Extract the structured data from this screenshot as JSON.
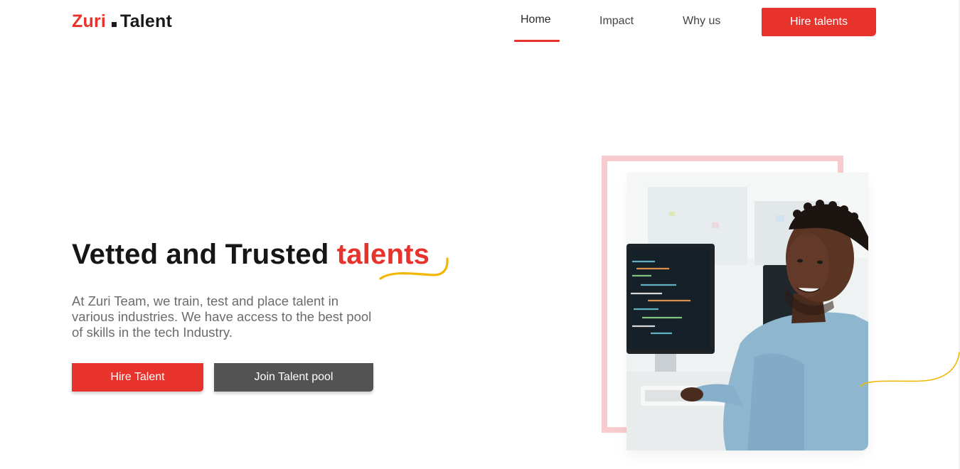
{
  "header": {
    "logo": {
      "part1": "Zuri",
      "part2": "Talent"
    },
    "nav": [
      {
        "label": "Home",
        "active": true
      },
      {
        "label": "Impact",
        "active": false
      },
      {
        "label": "Why us",
        "active": false
      }
    ],
    "cta_label": "Hire talents"
  },
  "hero": {
    "title_main": "Vetted and Trusted",
    "title_accent": "talents",
    "description": "At Zuri Team, we train, test and place talent in various industries. We have access to the best pool of skills in the tech Industry.",
    "primary_button": "Hire Talent",
    "secondary_button": "Join Talent pool"
  },
  "colors": {
    "brand_red": "#e8322c",
    "dark_button": "#535353",
    "accent_yellow": "#f2b705",
    "frame_pink": "#f8cccc",
    "text_dark": "#161616",
    "text_muted": "#6b6b6b"
  },
  "icons": {
    "logo_mark": "square-dot",
    "title_underline": "squiggle-underline",
    "decor_curve": "decorative-curve"
  }
}
